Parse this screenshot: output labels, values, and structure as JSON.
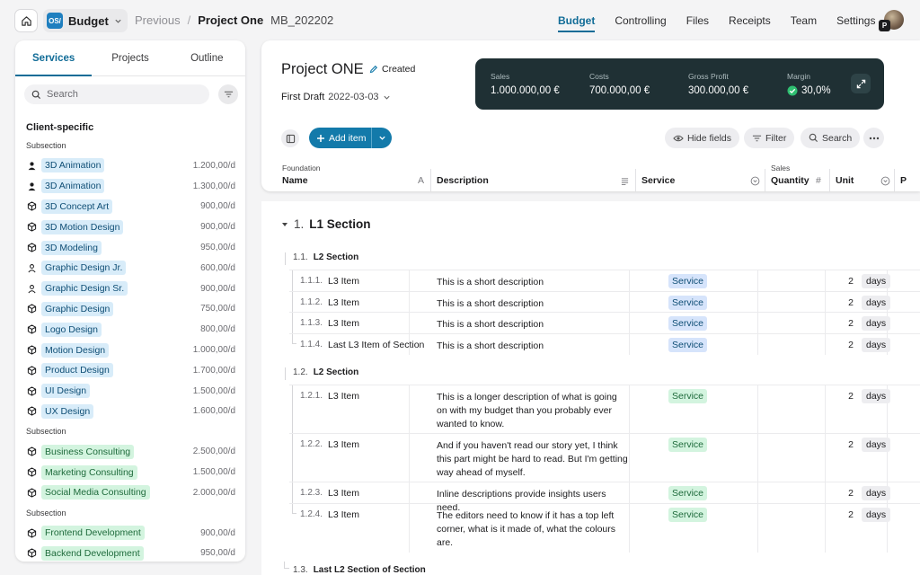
{
  "app": {
    "logo_text": "OS/",
    "name": "Budget"
  },
  "breadcrumb": {
    "previous": "Previous",
    "separator": "/",
    "current": "Project One",
    "id": "MB_202202"
  },
  "nav": {
    "tabs": [
      "Budget",
      "Controlling",
      "Files",
      "Receipts",
      "Team",
      "Settings"
    ],
    "active": "Budget"
  },
  "user": {
    "badge": "P"
  },
  "sidebar": {
    "tabs": [
      "Services",
      "Projects",
      "Outline"
    ],
    "active_tab": "Services",
    "search_placeholder": "Search",
    "group_title": "Client-specific",
    "subsections": [
      {
        "label": "Subsection",
        "items": [
          {
            "name": "3D Animation",
            "price": "1.200,00/d",
            "icon": "person-icon",
            "color": "blue"
          },
          {
            "name": "3D Animation",
            "price": "1.300,00/d",
            "icon": "person-icon",
            "color": "blue"
          },
          {
            "name": "3D Concept Art",
            "price": "900,00/d",
            "icon": "cube-icon",
            "color": "blue"
          },
          {
            "name": "3D Motion Design",
            "price": "900,00/d",
            "icon": "cube-icon",
            "color": "blue"
          },
          {
            "name": "3D Modeling",
            "price": "950,00/d",
            "icon": "cube-icon",
            "color": "blue"
          },
          {
            "name": "Graphic Design Jr.",
            "price": "600,00/d",
            "icon": "person-outline-icon",
            "color": "blue"
          },
          {
            "name": "Graphic Design Sr.",
            "price": "900,00/d",
            "icon": "person-outline-icon",
            "color": "blue"
          },
          {
            "name": "Graphic Design",
            "price": "750,00/d",
            "icon": "cube-icon",
            "color": "blue"
          },
          {
            "name": "Logo Design",
            "price": "800,00/d",
            "icon": "cube-icon",
            "color": "blue"
          },
          {
            "name": "Motion Design",
            "price": "1.000,00/d",
            "icon": "cube-icon",
            "color": "blue"
          },
          {
            "name": "Product Design",
            "price": "1.700,00/d",
            "icon": "cube-icon",
            "color": "blue"
          },
          {
            "name": "UI Design",
            "price": "1.500,00/d",
            "icon": "cube-icon",
            "color": "blue"
          },
          {
            "name": "UX Design",
            "price": "1.600,00/d",
            "icon": "cube-icon",
            "color": "blue"
          }
        ]
      },
      {
        "label": "Subsection",
        "items": [
          {
            "name": "Business Consulting",
            "price": "2.500,00/d",
            "icon": "cube-icon",
            "color": "green"
          },
          {
            "name": "Marketing Consulting",
            "price": "1.500,00/d",
            "icon": "cube-icon",
            "color": "green"
          },
          {
            "name": "Social Media Consulting",
            "price": "2.000,00/d",
            "icon": "cube-icon",
            "color": "green"
          }
        ]
      },
      {
        "label": "Subsection",
        "items": [
          {
            "name": "Frontend Development",
            "price": "900,00/d",
            "icon": "cube-icon",
            "color": "green"
          },
          {
            "name": "Backend Development",
            "price": "950,00/d",
            "icon": "cube-icon",
            "color": "green"
          }
        ]
      }
    ]
  },
  "project": {
    "title": "Project ONE",
    "status": "Created",
    "draft_label": "First Draft",
    "draft_date": "2022-03-03"
  },
  "kpis": [
    {
      "label": "Sales",
      "value": "1.000.000,00 €"
    },
    {
      "label": "Costs",
      "value": "700.000,00 €"
    },
    {
      "label": "Gross Profit",
      "value": "300.000,00 €"
    },
    {
      "label": "Margin",
      "value": "30,0%"
    }
  ],
  "toolbar": {
    "add_item": "Add item",
    "hide_fields": "Hide fields",
    "filter": "Filter",
    "search": "Search"
  },
  "columns": {
    "groups": {
      "foundation": "Foundation",
      "sales": "Sales"
    },
    "headers": [
      "Name",
      "Description",
      "Service",
      "Quantity",
      "Unit",
      "P"
    ]
  },
  "budget": {
    "l1": {
      "num": "1.",
      "title": "L1 Section"
    },
    "sections": [
      {
        "num": "1.1.",
        "title": "L2 Section",
        "rows": [
          {
            "num": "1.1.1.",
            "name": "L3 Item",
            "desc": "This is a short description",
            "service": "Service",
            "qty": "2",
            "unit": "days"
          },
          {
            "num": "1.1.2.",
            "name": "L3 Item",
            "desc": "This is a short description",
            "service": "Service",
            "qty": "2",
            "unit": "days"
          },
          {
            "num": "1.1.3.",
            "name": "L3 Item",
            "desc": "This is a short description",
            "service": "Service",
            "qty": "2",
            "unit": "days"
          },
          {
            "num": "1.1.4.",
            "name": "Last L3 Item of Section",
            "desc": "This is a short description",
            "service": "Service",
            "qty": "2",
            "unit": "days"
          }
        ]
      },
      {
        "num": "1.2.",
        "title": "L2 Section",
        "rows": [
          {
            "num": "1.2.1.",
            "name": "L3 Item",
            "desc": "This is a longer description of what is going on with my budget than you probably ever wanted to know.",
            "service": "Service",
            "qty": "2",
            "unit": "days"
          },
          {
            "num": "1.2.2.",
            "name": "L3 Item",
            "desc": "And if you haven't read our story yet, I think this part might be hard to read. But I'm getting way ahead of myself.",
            "service": "Service",
            "qty": "2",
            "unit": "days"
          },
          {
            "num": "1.2.3.",
            "name": "L3 Item",
            "desc": "Inline descriptions provide insights users need.",
            "service": "Service",
            "qty": "2",
            "unit": "days"
          },
          {
            "num": "1.2.4.",
            "name": "L3 Item",
            "desc": "The editors need to know if it has a top left corner, what is it made of, what the colours are.",
            "service": "Service",
            "qty": "2",
            "unit": "days"
          }
        ]
      },
      {
        "num": "1.3.",
        "title": "Last L2 Section of Section",
        "rows": []
      }
    ]
  },
  "colors": {
    "accent": "#116c97",
    "kpi_bg": "#1f3034",
    "chip_blue": "#d8ecf9",
    "chip_green": "#d3f4df",
    "margin_ok": "#2fbf71"
  }
}
